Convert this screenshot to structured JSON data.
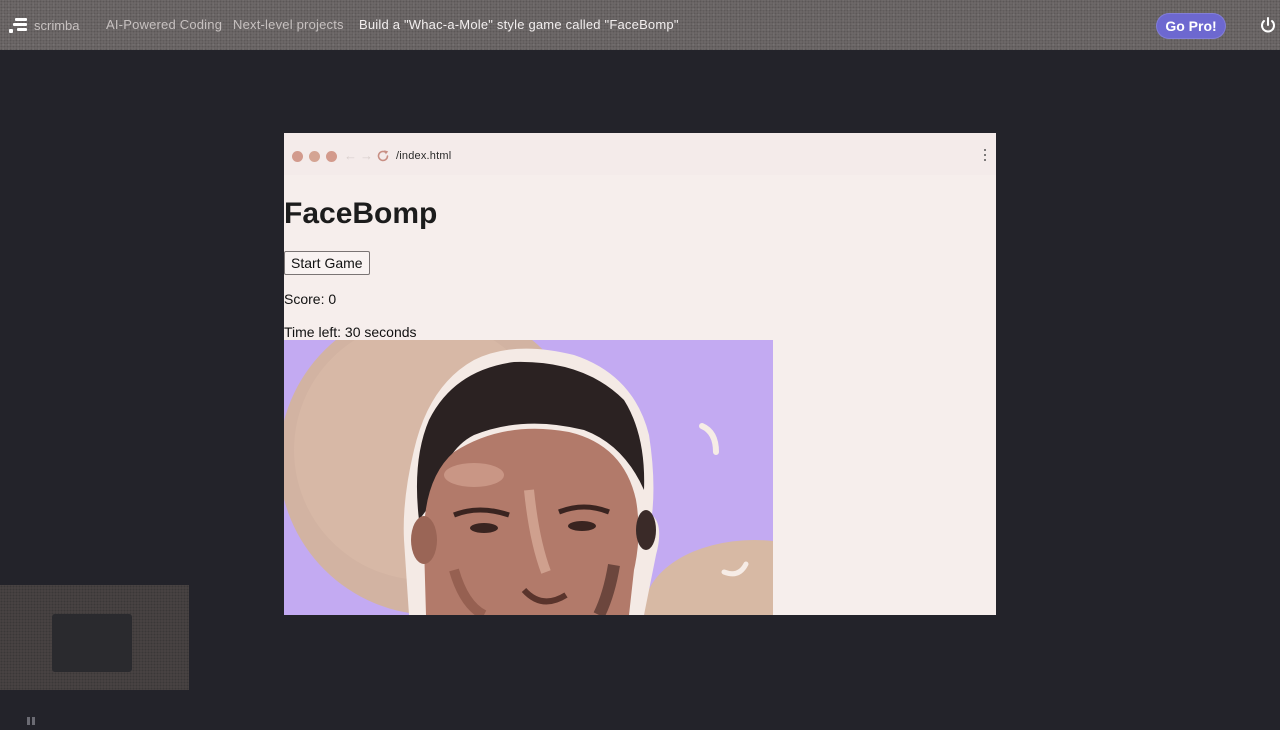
{
  "nav": {
    "brand": "scrimba",
    "crumbs": [
      "AI-Powered Coding",
      "Next-level projects"
    ],
    "current": "Build a \"Whac-a-Mole\" style game called \"FaceBomp\"",
    "go_pro_label": "Go Pro!",
    "power_icon": "power-icon"
  },
  "browser": {
    "url": "/index.html",
    "colors": {
      "background": "#f6eeec",
      "traffic": [
        "#d29a8d",
        "#d4a493",
        "#d39a8c"
      ]
    }
  },
  "page": {
    "title": "FaceBomp",
    "start_button": "Start Game",
    "score_text": "Score: 0",
    "time_text": "Time left: 30 seconds",
    "image_alt": "face-photo"
  },
  "colors": {
    "accent": "#6d68d0",
    "app_background": "#23232a",
    "topbar": "#6f6a6a"
  }
}
